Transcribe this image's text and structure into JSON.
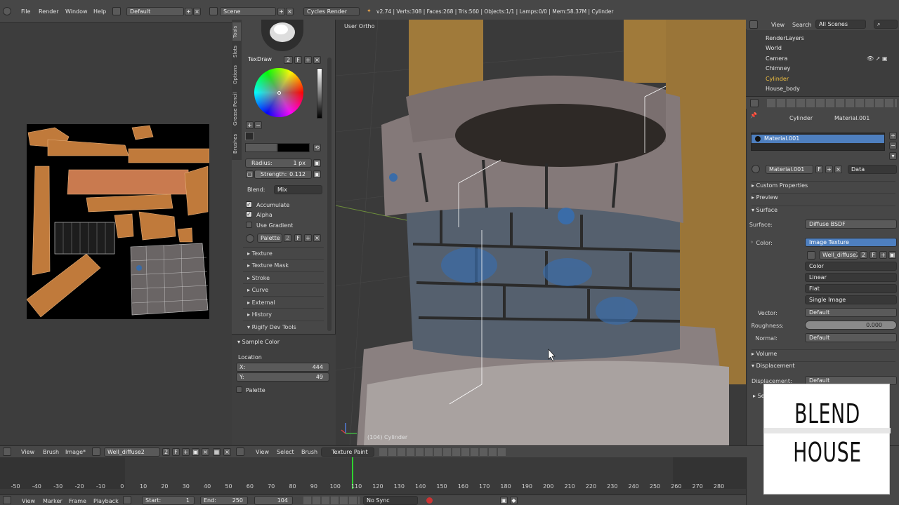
{
  "topbar": {
    "menus": [
      "File",
      "Render",
      "Window",
      "Help"
    ],
    "screen_layout": "Default",
    "scene": "Scene",
    "render_engine": "Cycles Render",
    "stats": "v2.74 | Verts:308 | Faces:268 | Tris:560 | Objects:1/1 | Lamps:0/0 | Mem:58.37M | Cylinder"
  },
  "tools": {
    "tabs": [
      "Tools",
      "Slots",
      "Options",
      "Grease Pencil",
      "Brushes"
    ],
    "brush_name": "TexDraw",
    "brush_users": "2",
    "brush_fake": "F",
    "radius_label": "Radius:",
    "radius_value": "1 px",
    "strength_label": "Strength:",
    "strength_value": "0.112",
    "blend_label": "Blend:",
    "blend_value": "Mix",
    "accumulate": "Accumulate",
    "alpha": "Alpha",
    "use_gradient": "Use Gradient",
    "palette": "Palette",
    "palette_users": "2",
    "palette_fake": "F",
    "sections": [
      "Texture",
      "Texture Mask",
      "Stroke",
      "Curve",
      "External",
      "History",
      "Rigify Dev Tools"
    ],
    "sample_color": "Sample Color",
    "location_label": "Location",
    "x_label": "X:",
    "x_value": "444",
    "y_label": "Y:",
    "y_value": "49",
    "palette_check": "Palette"
  },
  "viewport": {
    "view_name": "User Ortho",
    "object_label": "(104) Cylinder"
  },
  "outliner": {
    "menus": [
      "View",
      "Search"
    ],
    "scope": "All Scenes",
    "items": [
      "RenderLayers",
      "World",
      "Camera",
      "Chimney",
      "Cylinder",
      "House_body"
    ]
  },
  "properties": {
    "breadcrumb_object": "Cylinder",
    "breadcrumb_material": "Material.001",
    "slot_name": "Material.001",
    "material_name": "Material.001",
    "material_fake": "F",
    "link": "Data",
    "sections": [
      "Custom Properties",
      "Preview",
      "Surface"
    ],
    "surface_label": "Surface:",
    "surface_value": "Diffuse BSDF",
    "color_label": "Color:",
    "color_value": "Image Texture",
    "image_name": "Well_diffuse2",
    "image_users": "2",
    "image_fake": "F",
    "color_space": "Color",
    "interpolation": "Linear",
    "projection": "Flat",
    "source": "Single Image",
    "vector_label": "Vector:",
    "vector_value": "Default",
    "roughness_label": "Roughness:",
    "roughness_value": "0.000",
    "normal_label": "Normal:",
    "normal_value": "Default",
    "volume": "Volume",
    "displacement": "Displacement",
    "displacement_label": "Displacement:",
    "displacement_value": "Default",
    "settings_partial": "Se"
  },
  "bottombar": {
    "uv_menus": [
      "View",
      "Brush",
      "Image*"
    ],
    "image_name": "Well_diffuse2",
    "image_users": "2",
    "image_fake": "F",
    "view3d_menus": [
      "View",
      "Select",
      "Brush"
    ],
    "mode": "Texture Paint"
  },
  "timeline": {
    "ticks": [
      "-50",
      "-40",
      "-30",
      "-20",
      "-10",
      "0",
      "10",
      "20",
      "30",
      "40",
      "50",
      "60",
      "70",
      "80",
      "90",
      "100",
      "110",
      "120",
      "130",
      "140",
      "150",
      "160",
      "170",
      "180",
      "190",
      "200",
      "210",
      "220",
      "230",
      "240",
      "250",
      "260",
      "270",
      "280"
    ],
    "menus": [
      "View",
      "Marker",
      "Frame",
      "Playback"
    ],
    "start_label": "Start:",
    "start_value": "1",
    "end_label": "End:",
    "end_value": "250",
    "current_frame": "104",
    "sync": "No Sync"
  },
  "logo": {
    "line1": "BLEND",
    "line2": "HOUSE"
  },
  "colors": {
    "selection_blue": "#4e7fbf",
    "panel": "#474747",
    "frame_marker": "#2fd12f"
  }
}
